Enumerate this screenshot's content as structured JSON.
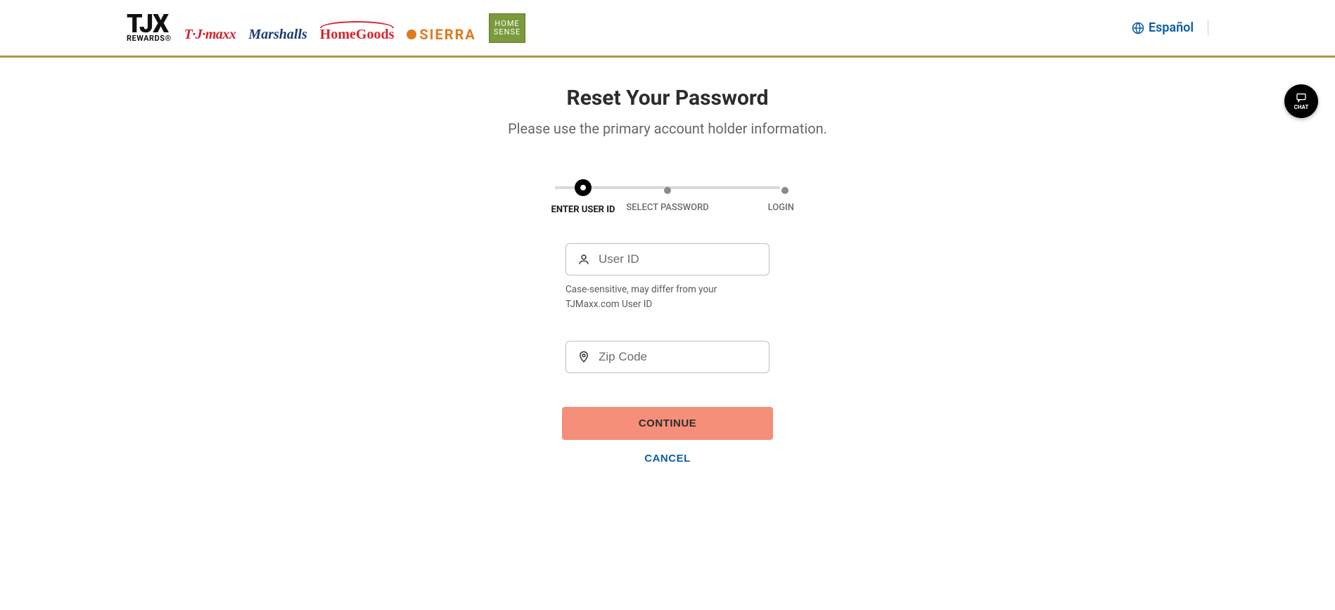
{
  "header": {
    "logo_main": "TJX",
    "logo_sub": "REWARDS®",
    "brands": {
      "tjmaxx": "T·J·maxx",
      "marshalls": "Marshalls",
      "homegoods": "HomeGoods",
      "sierra": "SIERRA",
      "homesense_line1": "HOME",
      "homesense_line2": "SENSE"
    },
    "language_label": "Español"
  },
  "main": {
    "title": "Reset Your Password",
    "subtitle": "Please use the primary account holder information."
  },
  "stepper": {
    "steps": [
      {
        "label": "ENTER USER ID",
        "active": true
      },
      {
        "label": "SELECT PASSWORD",
        "active": false
      },
      {
        "label": "LOGIN",
        "active": false
      }
    ]
  },
  "form": {
    "user_id": {
      "placeholder": "User ID",
      "value": "",
      "hint": "Case-sensitive, may differ from your TJMaxx.com User ID"
    },
    "zip": {
      "placeholder": "Zip Code",
      "value": ""
    },
    "continue_label": "CONTINUE",
    "cancel_label": "CANCEL"
  },
  "chat": {
    "label": "CHAT"
  }
}
